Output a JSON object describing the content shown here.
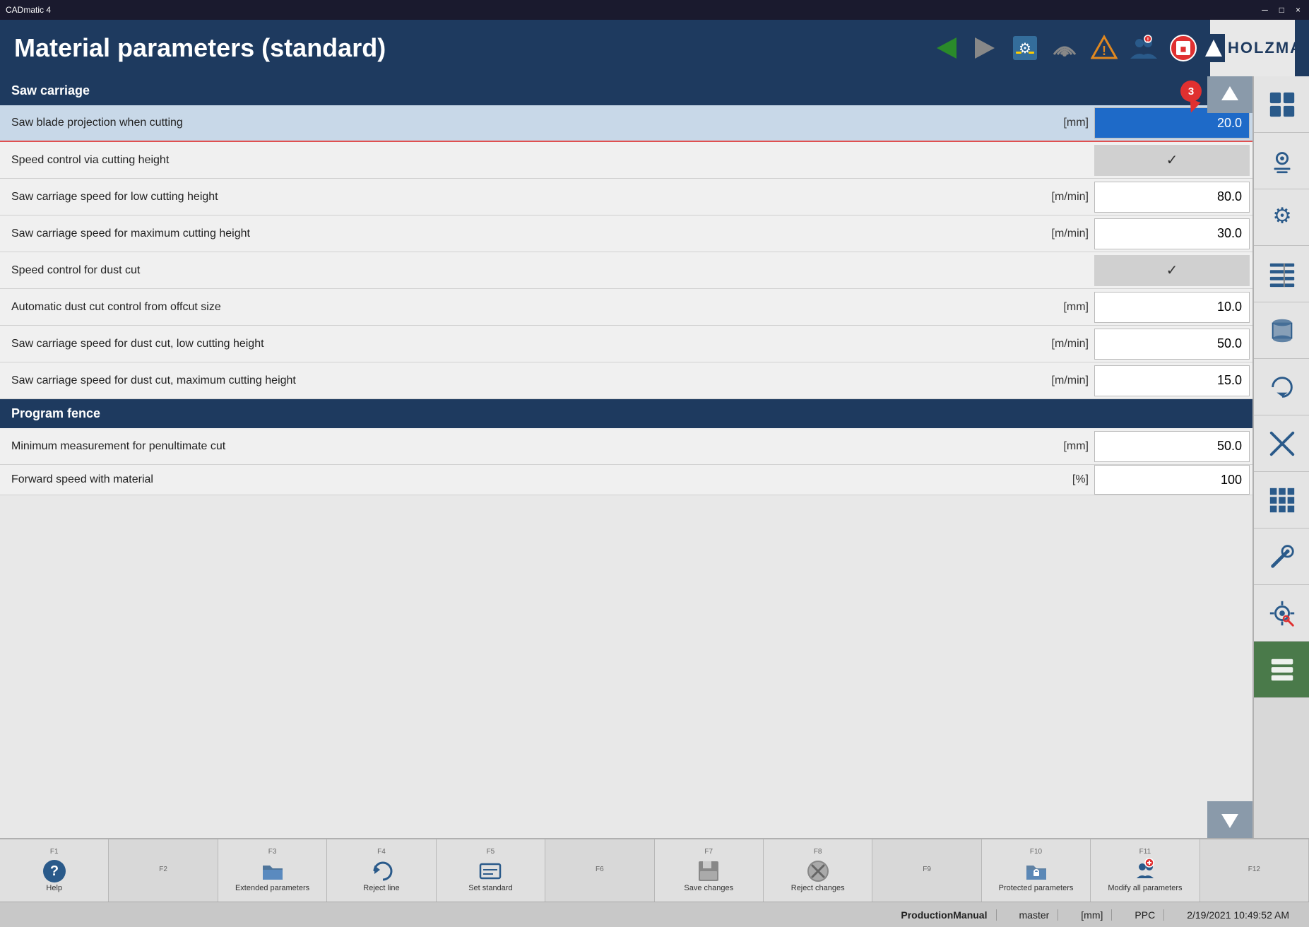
{
  "titleBar": {
    "appName": "CADmatic 4",
    "controls": [
      "_",
      "□",
      "×"
    ]
  },
  "header": {
    "title": "Material parameters (standard)",
    "toolbarButtons": [
      {
        "name": "back",
        "icon": "◀",
        "color": "#2a8a2a"
      },
      {
        "name": "forward",
        "icon": "▶",
        "color": "#888"
      },
      {
        "name": "settings1",
        "icon": "⚙"
      },
      {
        "name": "wifi",
        "icon": "wifi"
      },
      {
        "name": "warning",
        "icon": "⚠"
      },
      {
        "name": "users",
        "icon": "👥"
      },
      {
        "name": "stop",
        "icon": "⛔"
      }
    ],
    "logo": "HOLZMA"
  },
  "sections": [
    {
      "id": "saw-carriage",
      "label": "Saw carriage",
      "badge": "3",
      "rows": [
        {
          "label": "Saw blade projection when cutting",
          "unit": "[mm]",
          "value": "20.0",
          "type": "value",
          "selected": true,
          "highlighted": true
        },
        {
          "label": "Speed control via cutting height",
          "unit": "",
          "value": "✓",
          "type": "checkbox"
        },
        {
          "label": "Saw carriage speed for low cutting height",
          "unit": "[m/min]",
          "value": "80.0",
          "type": "value"
        },
        {
          "label": "Saw carriage speed for maximum cutting height",
          "unit": "[m/min]",
          "value": "30.0",
          "type": "value"
        },
        {
          "label": "Speed control for dust cut",
          "unit": "",
          "value": "✓",
          "type": "checkbox"
        },
        {
          "label": "Automatic dust cut control from offcut size",
          "unit": "[mm]",
          "value": "10.0",
          "type": "value"
        },
        {
          "label": "Saw carriage speed for dust cut, low cutting height",
          "unit": "[m/min]",
          "value": "50.0",
          "type": "value"
        },
        {
          "label": "Saw carriage speed for dust cut, maximum cutting height",
          "unit": "[m/min]",
          "value": "15.0",
          "type": "value"
        }
      ]
    },
    {
      "id": "program-fence",
      "label": "Program fence",
      "rows": [
        {
          "label": "Minimum measurement for penultimate cut",
          "unit": "[mm]",
          "value": "50.0",
          "type": "value"
        },
        {
          "label": "Forward speed with material",
          "unit": "[%]",
          "value": "100",
          "type": "value",
          "partial": true
        }
      ]
    }
  ],
  "fkeys": [
    {
      "key": "F1",
      "label": "Help",
      "icon": "help",
      "enabled": true
    },
    {
      "key": "F2",
      "label": "",
      "icon": "",
      "enabled": false
    },
    {
      "key": "F3",
      "label": "Extended parameters",
      "icon": "folder",
      "enabled": true
    },
    {
      "key": "F4",
      "label": "Reject line",
      "icon": "undo",
      "enabled": true
    },
    {
      "key": "F5",
      "label": "Set standard",
      "icon": "set-standard",
      "enabled": true
    },
    {
      "key": "F6",
      "label": "",
      "icon": "",
      "enabled": false
    },
    {
      "key": "F7",
      "label": "Save changes",
      "icon": "save",
      "enabled": true
    },
    {
      "key": "F8",
      "label": "Reject changes",
      "icon": "reject",
      "enabled": true
    },
    {
      "key": "F9",
      "label": "",
      "icon": "",
      "enabled": false
    },
    {
      "key": "F10",
      "label": "Protected parameters",
      "icon": "folder-lock",
      "enabled": true
    },
    {
      "key": "F11",
      "label": "Modify all parameters",
      "icon": "modify",
      "enabled": true
    },
    {
      "key": "F12",
      "label": "",
      "icon": "",
      "enabled": false
    }
  ],
  "statusBar": {
    "left": "",
    "center": "ProductionManual",
    "mode": "master",
    "unit": "[mm]",
    "system": "PPC",
    "datetime": "2/19/2021 10:49:52 AM"
  },
  "rightPanel": {
    "items": [
      {
        "icon": "grid",
        "label": "main-menu"
      },
      {
        "icon": "gear-detail",
        "label": "settings-detail"
      },
      {
        "icon": "gear-settings",
        "label": "gear-settings"
      },
      {
        "icon": "columns",
        "label": "columns-icon"
      },
      {
        "icon": "cylinder",
        "label": "cylinder-icon"
      },
      {
        "icon": "rotate",
        "label": "rotate-icon"
      },
      {
        "icon": "x-cross",
        "label": "x-cross-icon"
      },
      {
        "icon": "grid2",
        "label": "grid2-icon"
      },
      {
        "icon": "tool-set",
        "label": "tool-set-icon"
      },
      {
        "icon": "cog-wrench",
        "label": "cog-wrench-icon"
      },
      {
        "icon": "stack",
        "label": "stack-icon-active"
      }
    ]
  }
}
